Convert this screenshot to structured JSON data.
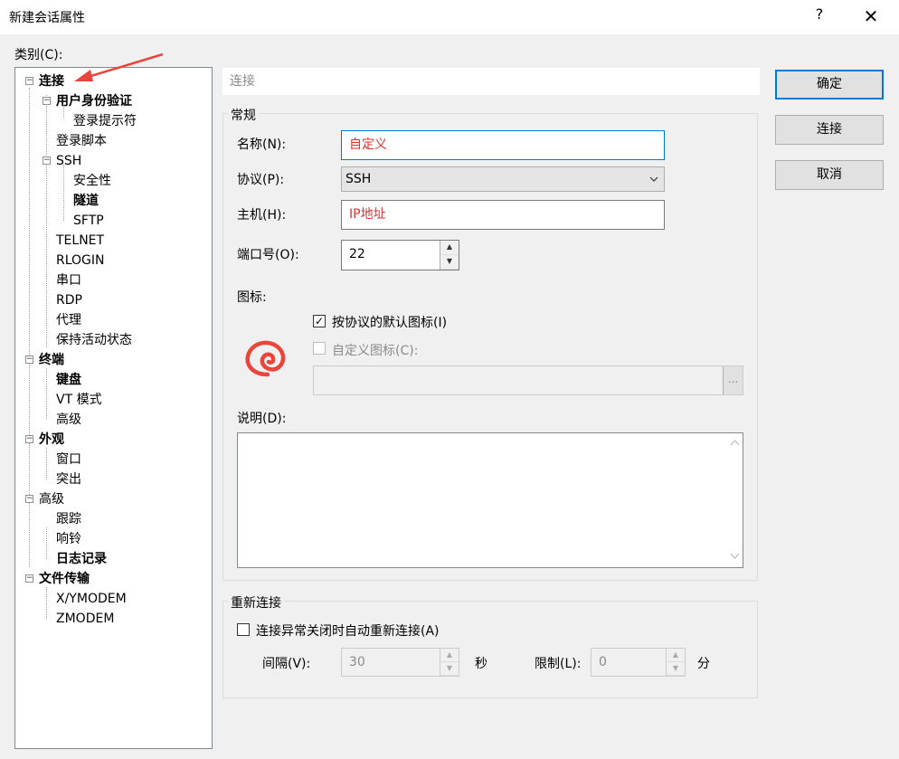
{
  "window": {
    "title": "新建会话属性",
    "help": "?",
    "close": "✕"
  },
  "category_label": "类别(C):",
  "tree": [
    {
      "label": "连接",
      "bold": true
    },
    {
      "label": "用户身份验证",
      "bold": true
    },
    {
      "label": "登录提示符",
      "bold": false
    },
    {
      "label": "登录脚本",
      "bold": false
    },
    {
      "label": "SSH",
      "bold": false
    },
    {
      "label": "安全性",
      "bold": false
    },
    {
      "label": "隧道",
      "bold": true
    },
    {
      "label": "SFTP",
      "bold": false
    },
    {
      "label": "TELNET",
      "bold": false
    },
    {
      "label": "RLOGIN",
      "bold": false
    },
    {
      "label": "串口",
      "bold": false
    },
    {
      "label": "RDP",
      "bold": false
    },
    {
      "label": "代理",
      "bold": false
    },
    {
      "label": "保持活动状态",
      "bold": false
    },
    {
      "label": "终端",
      "bold": true
    },
    {
      "label": "键盘",
      "bold": true
    },
    {
      "label": "VT 模式",
      "bold": false
    },
    {
      "label": "高级",
      "bold": false
    },
    {
      "label": "外观",
      "bold": true
    },
    {
      "label": "窗口",
      "bold": false
    },
    {
      "label": "突出",
      "bold": false
    },
    {
      "label": "高级",
      "bold": false
    },
    {
      "label": "跟踪",
      "bold": false
    },
    {
      "label": "响铃",
      "bold": false
    },
    {
      "label": "日志记录",
      "bold": true
    },
    {
      "label": "文件传输",
      "bold": true
    },
    {
      "label": "X/YMODEM",
      "bold": false
    },
    {
      "label": "ZMODEM",
      "bold": false
    }
  ],
  "section_header": "连接",
  "general": {
    "title": "常规",
    "name_label": "名称(N):",
    "name_value": "自定义",
    "protocol_label": "协议(P):",
    "protocol_value": "SSH",
    "host_label": "主机(H):",
    "host_value": "IP地址",
    "port_label": "端口号(O):",
    "port_value": "22",
    "icon_label": "图标:",
    "default_icon_label": "按协议的默认图标(I)",
    "default_icon_checked": true,
    "custom_icon_label": "自定义图标(C):",
    "custom_icon_checked": false,
    "browse_label": "...",
    "description_label": "说明(D):"
  },
  "reconnect": {
    "title": "重新连接",
    "auto_label": "连接异常关闭时自动重新连接(A)",
    "auto_checked": false,
    "interval_label": "间隔(V):",
    "interval_value": "30",
    "interval_unit": "秒",
    "limit_label": "限制(L):",
    "limit_value": "0",
    "limit_unit": "分"
  },
  "buttons": {
    "ok": "确定",
    "connect": "连接",
    "cancel": "取消"
  },
  "colors": {
    "accent": "#0078d7",
    "highlight_text": "#e03131",
    "icon": "#e8453c"
  }
}
